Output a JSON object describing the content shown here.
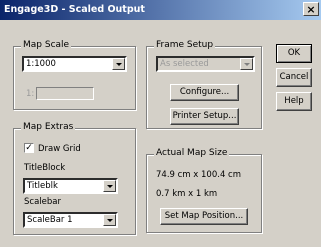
{
  "window": {
    "title": "Engage3D - Scaled Output",
    "close_symbol": "×"
  },
  "map_scale": {
    "label": "Map Scale",
    "selected": "1:1000",
    "ratio_prefix": "1:"
  },
  "frame_setup": {
    "label": "Frame Setup",
    "selected": "As selected",
    "configure_label": "Configure...",
    "printer_setup_label": "Printer Setup..."
  },
  "actions": {
    "ok_label": "OK",
    "cancel_label": "Cancel",
    "help_label": "Help"
  },
  "map_extras": {
    "label": "Map Extras",
    "draw_grid_label": "Draw Grid",
    "draw_grid_checked": true,
    "titleblock_label": "TitleBlock",
    "titleblock_selected": "Titleblk",
    "scalebar_label": "Scalebar",
    "scalebar_selected": "ScaleBar 1"
  },
  "actual_map_size": {
    "label": "Actual Map Size",
    "size_cm": "74.9 cm x 100.4 cm",
    "size_km": "0.7 km  x  1 km",
    "set_position_label": "Set Map Position..."
  }
}
